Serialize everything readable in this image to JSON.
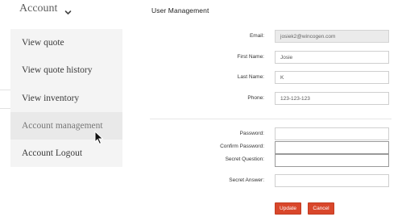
{
  "account_menu": {
    "toggle_label": "Account",
    "items": [
      {
        "label": "View quote"
      },
      {
        "label": "View quote history"
      },
      {
        "label": "View inventory"
      },
      {
        "label": "Account management",
        "hovered": true
      },
      {
        "label": "Account Logout"
      }
    ]
  },
  "user_management": {
    "title": "User Management",
    "fields": {
      "email": {
        "label": "Email:",
        "value": "josiek2@wincogen.com"
      },
      "first_name": {
        "label": "First Name:",
        "value": "Josie"
      },
      "last_name": {
        "label": "Last Name:",
        "value": "K"
      },
      "phone": {
        "label": "Phone:",
        "value": "123-123-123"
      },
      "password": {
        "label": "Password:",
        "value": ""
      },
      "confirm_password": {
        "label": "Confirm Password:",
        "value": ""
      },
      "secret_question": {
        "label": "Secret Question:",
        "value": ""
      },
      "secret_answer": {
        "label": "Secret Answer:",
        "value": ""
      }
    },
    "buttons": {
      "update": "Update",
      "cancel": "Cancel"
    }
  },
  "colors": {
    "accent": "#d9472b",
    "menu_bg": "#f4f4f4",
    "menu_hover_bg": "#e9e9e9"
  },
  "icons": {
    "toggle": "chevron-down-icon",
    "cursor": "mouse-pointer-icon"
  }
}
